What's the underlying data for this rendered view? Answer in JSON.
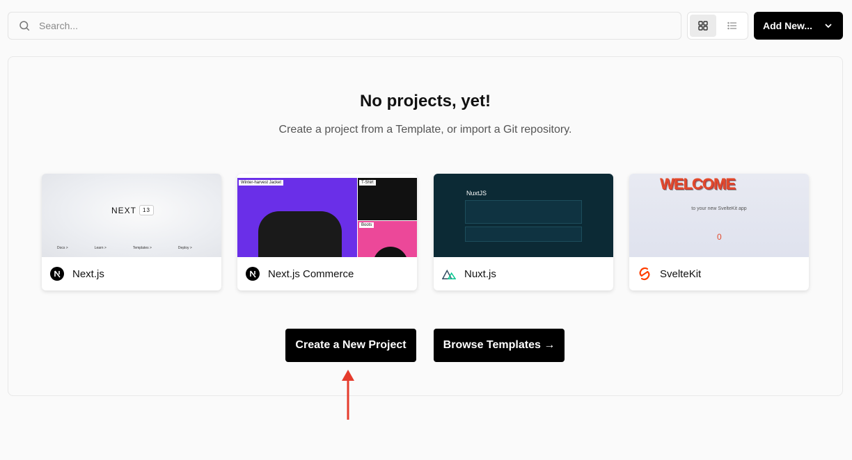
{
  "search": {
    "placeholder": "Search..."
  },
  "view_toggle": {
    "active": "grid"
  },
  "add_new": {
    "label": "Add New..."
  },
  "empty_state": {
    "title": "No projects, yet!",
    "subtitle": "Create a project from a Template, or import a Git repository."
  },
  "templates": [
    {
      "name": "Next.js",
      "icon": "nextjs-logo-icon",
      "preview": {
        "brand": "NEXT",
        "version": "13",
        "links": [
          "Docs >",
          "Learn >",
          "Templates >",
          "Deploy >"
        ]
      }
    },
    {
      "name": "Next.js Commerce",
      "icon": "nextjs-logo-icon",
      "preview": {
        "labels": [
          "Winter-harvest Jacket",
          "T-Shirt",
          "Boots"
        ]
      }
    },
    {
      "name": "Nuxt.js",
      "icon": "nuxt-logo-icon",
      "preview": {
        "brand": "NuxtJS"
      }
    },
    {
      "name": "SvelteKit",
      "icon": "svelte-logo-icon",
      "preview": {
        "headline": "WELCOME",
        "text": "to your new SvelteKit app",
        "counter": "0"
      }
    }
  ],
  "actions": {
    "create_label": "Create a New Project",
    "browse_label": "Browse Templates →"
  },
  "colors": {
    "accent": "#000000",
    "annotation_arrow": "#e53b2c",
    "commerce_purple": "#6a2fe8",
    "nuxt_bg": "#0c2a35",
    "svelte_orange": "#ff3e00"
  }
}
